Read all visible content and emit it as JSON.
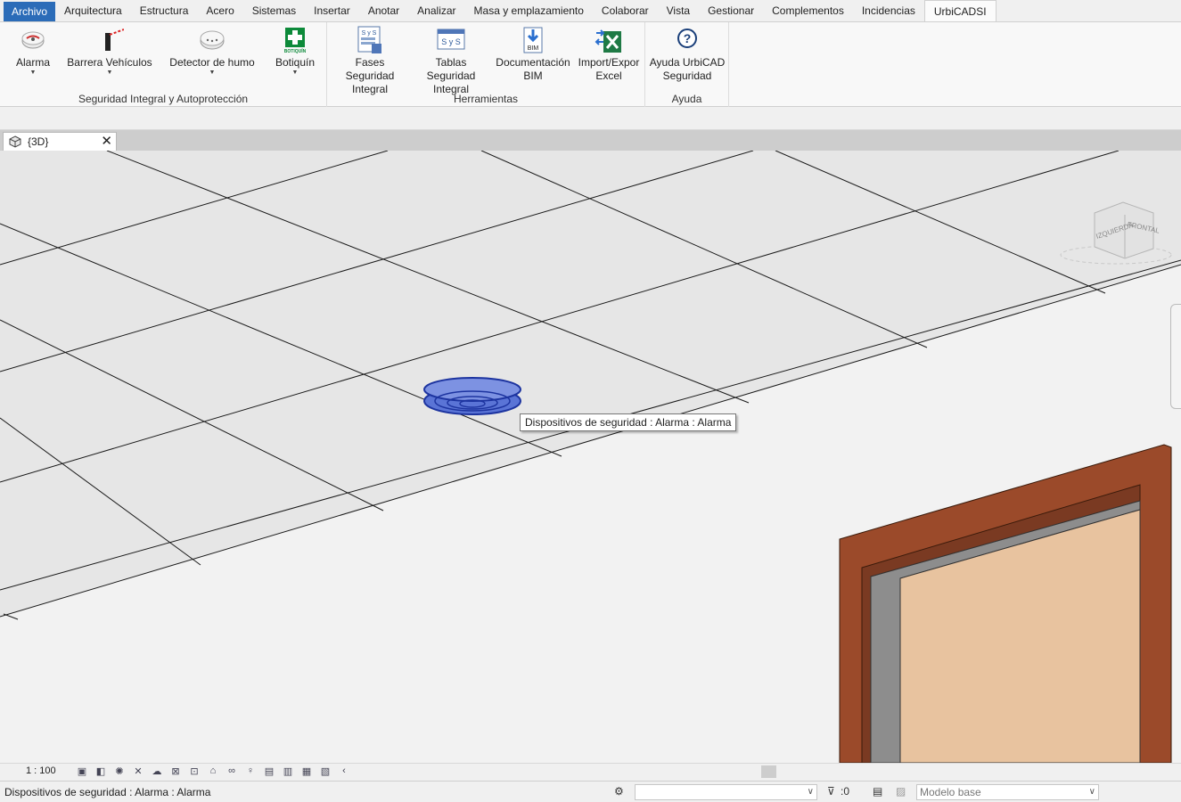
{
  "menu": {
    "tabs": [
      "Archivo",
      "Arquitectura",
      "Estructura",
      "Acero",
      "Sistemas",
      "Insertar",
      "Anotar",
      "Analizar",
      "Masa y emplazamiento",
      "Colaborar",
      "Vista",
      "Gestionar",
      "Complementos",
      "Incidencias",
      "UrbiCADSI"
    ],
    "active": "UrbiCADSI"
  },
  "ribbon": {
    "panel1": {
      "title": "Seguridad Integral y Autoprotección",
      "alarma": "Alarma",
      "barrera": "Barrera Vehículos",
      "detector": "Detector de humo",
      "botiquin": "Botiquín",
      "botiquin_icon_text": "BOTIQUÍN"
    },
    "panel2": {
      "title": "Herramientas",
      "fases": [
        "Fases Seguridad",
        "Integral"
      ],
      "tablas": [
        "Tablas Seguridad",
        "Integral"
      ],
      "doc": [
        "Documentación",
        "BIM"
      ],
      "excel": [
        "Import/Expor",
        "Excel"
      ],
      "sys_icon_text": "S y S",
      "bim_icon_text": "BIM"
    },
    "panel3": {
      "title": "Ayuda",
      "ayuda": [
        "Ayuda UrbiCAD",
        "Seguridad"
      ]
    }
  },
  "view_tab": {
    "label": "{3D}",
    "close": "✕"
  },
  "viewport": {
    "tooltip": "Dispositivos de seguridad : Alarma : Alarma",
    "viewcube_left": "IZQUIERDA",
    "viewcube_front": "FRONTAL"
  },
  "view_controls": {
    "scale": "1 : 100"
  },
  "status": {
    "text": "Dispositivos de seguridad : Alarma : Alarma",
    "filter_count": ":0",
    "model": "Modelo base"
  },
  "colors": {
    "file_tab": "#2b6cb8",
    "door_frame": "#9b4a2a",
    "door_leaf": "#e8c39f",
    "alarm_blue": "#2e4fc7"
  }
}
